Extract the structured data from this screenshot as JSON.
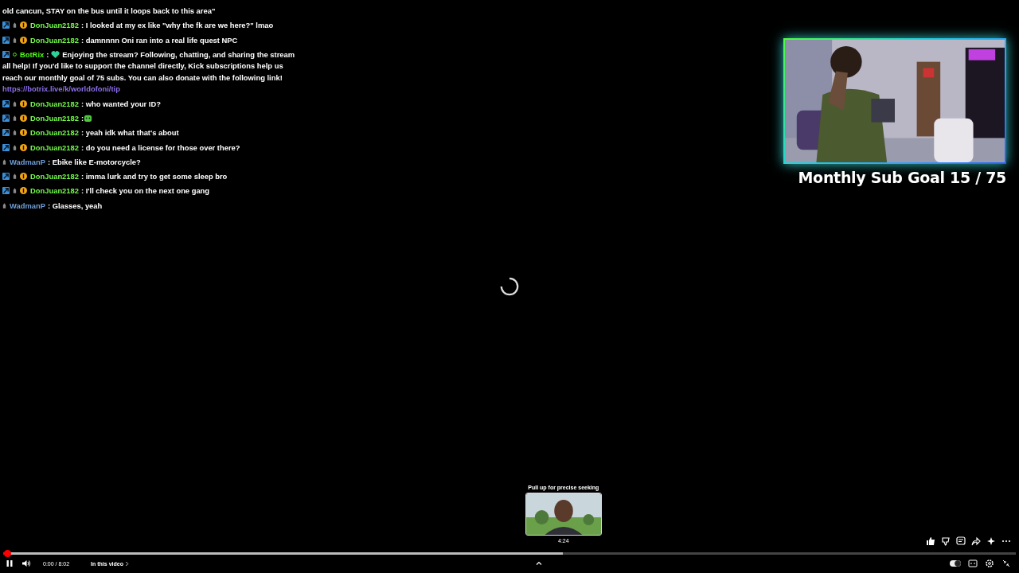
{
  "chat": [
    {
      "kind": "continuation",
      "text": "old cancun, STAY on the bus until it loops back to this area\""
    },
    {
      "kind": "text",
      "user": "DonJuan2182",
      "color": "#75fb4c",
      "badges": [
        {
          "kind": "boost"
        },
        {
          "kind": "tier"
        },
        {
          "kind": "coin"
        }
      ],
      "text": ": I looked at my ex like \"why the fk are we here?\" lmao"
    },
    {
      "kind": "text",
      "user": "DonJuan2182",
      "color": "#75fb4c",
      "badges": [
        {
          "kind": "boost"
        },
        {
          "kind": "tier"
        },
        {
          "kind": "coin"
        }
      ],
      "text": ": damnnnn Oni ran into a real life quest NPC"
    },
    {
      "kind": "bot",
      "user": "BotRix",
      "color": "#53fc18",
      "badges": [
        {
          "kind": "boost"
        },
        {
          "kind": "dot"
        }
      ],
      "separator": ":",
      "lines": [
        "Enjoying the stream? Following, chatting, and sharing the stream",
        "all help! If you'd like to support the channel directly, Kick subscriptions help us",
        "reach our monthly goal of 75 subs. You can also donate with the following link!"
      ],
      "link": "https://botrix.live/k/worldofoni/tip"
    },
    {
      "kind": "text",
      "user": "DonJuan2182",
      "color": "#75fb4c",
      "badges": [
        {
          "kind": "boost"
        },
        {
          "kind": "tier"
        },
        {
          "kind": "coin"
        }
      ],
      "text": ": who wanted your ID?"
    },
    {
      "kind": "emote",
      "user": "DonJuan2182",
      "color": "#75fb4c",
      "badges": [
        {
          "kind": "boost"
        },
        {
          "kind": "tier"
        },
        {
          "kind": "coin"
        }
      ],
      "text": ":"
    },
    {
      "kind": "text",
      "user": "DonJuan2182",
      "color": "#75fb4c",
      "badges": [
        {
          "kind": "boost"
        },
        {
          "kind": "tier"
        },
        {
          "kind": "coin"
        }
      ],
      "text": ": yeah idk what that's about"
    },
    {
      "kind": "text",
      "user": "DonJuan2182",
      "color": "#75fb4c",
      "badges": [
        {
          "kind": "boost"
        },
        {
          "kind": "tier"
        },
        {
          "kind": "coin"
        }
      ],
      "text": ": do you need a license for those over there?"
    },
    {
      "kind": "text",
      "user": "WadmanP",
      "color": "#6f9fd8",
      "badges": [
        {
          "kind": "tier"
        }
      ],
      "text": ": Ebike like E-motorcycle?"
    },
    {
      "kind": "text",
      "user": "DonJuan2182",
      "color": "#75fb4c",
      "badges": [
        {
          "kind": "boost"
        },
        {
          "kind": "tier"
        },
        {
          "kind": "coin"
        }
      ],
      "text": ": imma lurk and try to get some sleep bro"
    },
    {
      "kind": "text",
      "user": "DonJuan2182",
      "color": "#75fb4c",
      "badges": [
        {
          "kind": "boost"
        },
        {
          "kind": "tier"
        },
        {
          "kind": "coin"
        }
      ],
      "text": ": I'll check you on the next one gang"
    },
    {
      "kind": "text",
      "user": "WadmanP",
      "color": "#6f9fd8",
      "badges": [
        {
          "kind": "tier"
        }
      ],
      "text": ": Glasses, yeah"
    }
  ],
  "webcam": {
    "kind": "picture",
    "caption": "Monthly Sub Goal 15 / 75"
  },
  "loading": true,
  "preview": {
    "hint": "Pull up for precise seeking",
    "time": "4:24"
  },
  "player": {
    "playing": true,
    "progress": {
      "level": 0.004
    },
    "hover": {
      "level": 0.553
    },
    "time": "0:00 / 8:02",
    "chapters": "In this video",
    "autoplay": true
  }
}
